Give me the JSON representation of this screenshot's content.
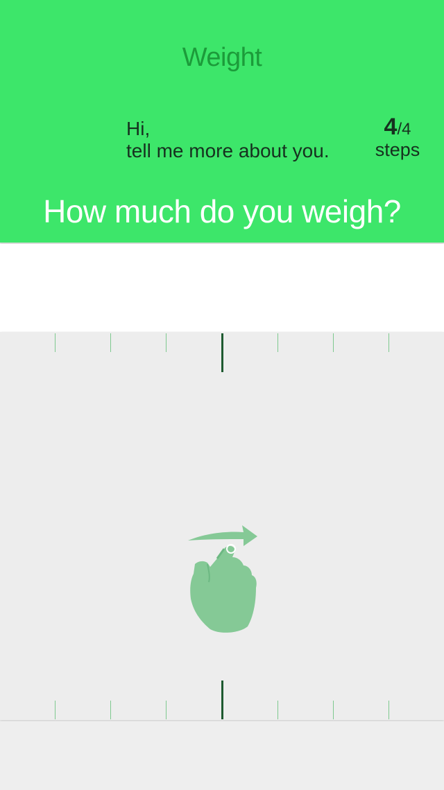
{
  "header": {
    "title": "Weight",
    "greeting_line1": "Hi,",
    "greeting_line2": "tell me more about you.",
    "step_current": "4",
    "step_separator": "/",
    "step_total": "4",
    "step_label": "steps",
    "question": "How much do you weigh?"
  },
  "colors": {
    "accent": "#3de66a",
    "title_text": "#1c9b3a",
    "dark_text": "#16311f",
    "ruler_tick": "#7dc98e",
    "ruler_center": "#1e5a30",
    "hint_hand": "#85c996"
  },
  "icons": {
    "swipe_hint": "swipe-hand-icon"
  }
}
